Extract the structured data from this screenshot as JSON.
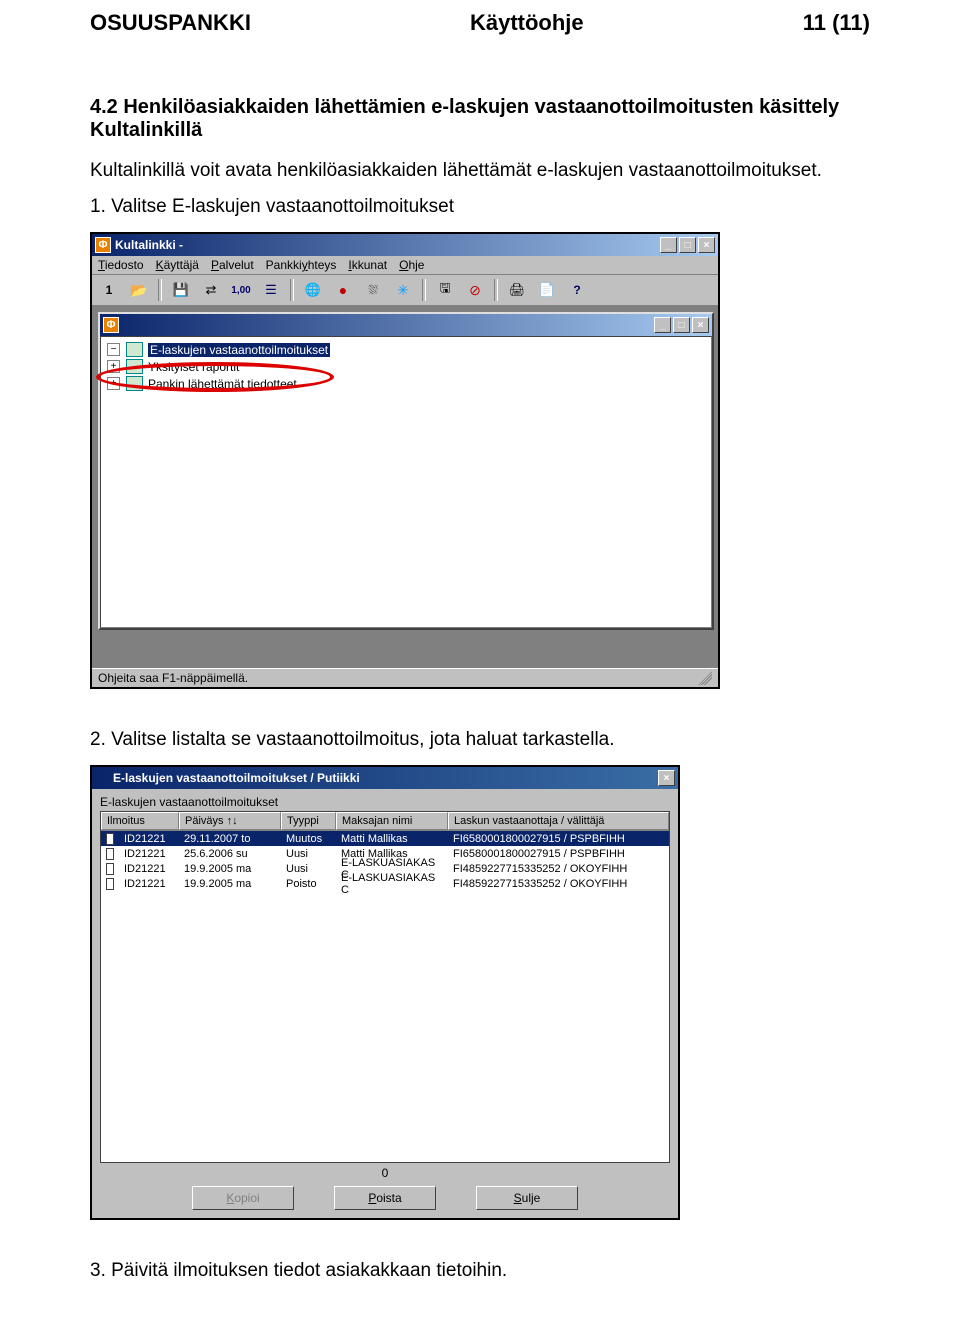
{
  "doc": {
    "org": "OSUUSPANKKI",
    "title": "Käyttöohje",
    "page_no": "11 (11)",
    "section_heading": "4.2 Henkilöasiakkaiden lähettämien e-laskujen vastaanottoilmoitusten käsittely Kultalinkillä",
    "para1": "Kultalinkillä voit avata henkilöasiakkaiden lähettämät e-laskujen vastaanottoilmoitukset.",
    "step1": "1. Valitse E-laskujen vastaanottoilmoitukset",
    "step2": "2. Valitse listalta se vastaanottoilmoitus, jota haluat tarkastella.",
    "step3": "3. Päivitä ilmoituksen tiedot asiakakkaan tietoihin."
  },
  "shot1": {
    "app_title": "Kultalinkki -",
    "menus": [
      "Tiedosto",
      "Käyttäjä",
      "Palvelut",
      "Pankkiyhteys",
      "Ikkunat",
      "Ohje"
    ],
    "toolbar1_text": "1",
    "tree_items": [
      "E-laskujen vastaanottoilmoitukset",
      "Yksityiset raportit",
      "Pankin lähettämät tiedotteet"
    ],
    "status": "Ohjeita saa F1-näppäimellä."
  },
  "shot2": {
    "title": "E-laskujen vastaanottoilmoitukset /         Putiikki",
    "list_label": "E-laskujen vastaanottoilmoitukset",
    "columns": [
      "Ilmoitus",
      "Päiväys  ↑↓",
      "Tyyppi",
      "Maksajan nimi",
      "Laskun vastaanottaja / välittäjä"
    ],
    "rows": [
      {
        "id": "ID21221",
        "date": "29.11.2007 to",
        "type": "Muutos",
        "payer": "Matti Mallikas",
        "recipient": "FI6580001800027915 / PSPBFIHH",
        "sel": true
      },
      {
        "id": "ID21221",
        "date": "25.6.2006 su",
        "type": "Uusi",
        "payer": "Matti Mallikas",
        "recipient": "FI6580001800027915 / PSPBFIHH",
        "sel": false
      },
      {
        "id": "ID21221",
        "date": "19.9.2005 ma",
        "type": "Uusi",
        "payer": "E-LASKUASIAKAS C",
        "recipient": "FI4859227715335252 / OKOYFIHH",
        "sel": false
      },
      {
        "id": "ID21221",
        "date": "19.9.2005 ma",
        "type": "Poisto",
        "payer": "E-LASKUASIAKAS C",
        "recipient": "FI4859227715335252 / OKOYFIHH",
        "sel": false
      }
    ],
    "count": "0",
    "buttons": {
      "copy": "Kopioi",
      "delete": "Poista",
      "close": "Sulje"
    }
  }
}
